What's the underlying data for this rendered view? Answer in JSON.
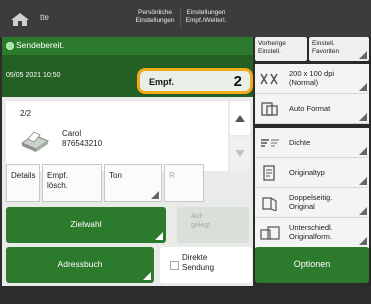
{
  "topbar": {
    "home_label": "tte",
    "btn_personal_line1": "Persönliche",
    "btn_personal_line2": "Einstellungen",
    "btn_settings_line1": "Einstellungen",
    "btn_settings_line2": "Empf./Weiterl."
  },
  "status": {
    "text": "Sendebereit.",
    "datetime": "05/05 2021 10:50"
  },
  "empf": {
    "label": "Empf.",
    "count": "2"
  },
  "destination": {
    "counter": "2/2",
    "name": "Carol",
    "number": "876543210"
  },
  "tabs": [
    {
      "line1": "Details",
      "line2": ""
    },
    {
      "line1": "Empf.",
      "line2": "lösch."
    },
    {
      "line1": "Ton",
      "line2": ""
    },
    {
      "line1": "R",
      "line2": ""
    }
  ],
  "buttons": {
    "zielwahl": "Zielwahl",
    "aufgelegt_line1": "Auf-",
    "aufgelegt_line2": "gelegt",
    "adressbuch": "Adressbuch",
    "direkte_line1": "Direkte",
    "direkte_line2": "Sendung",
    "optionen": "Optionen"
  },
  "right_top": {
    "vorherige_line1": "Vorherige",
    "vorherige_line2": "Einstell.",
    "favoriten_line1": "Einstell.",
    "favoriten_line2": "Favoriten"
  },
  "settings": [
    {
      "icon": "resolution-icon",
      "line1": "200 x 100 dpi",
      "line2": "(Normal)"
    },
    {
      "icon": "auto-format-icon",
      "line1": "Auto Format",
      "line2": ""
    },
    {
      "icon": "density-icon",
      "line1": "Dichte",
      "line2": ""
    },
    {
      "icon": "original-type-icon",
      "line1": "Originaltyp",
      "line2": ""
    },
    {
      "icon": "duplex-original-icon",
      "line1": "Doppelseitig.",
      "line2": "Original"
    },
    {
      "icon": "different-size-icon",
      "line1": "Unterschiedl.",
      "line2": "Originalform."
    }
  ],
  "colors": {
    "accent_green": "#2c7a2c",
    "highlight_orange": "#f2a91c"
  }
}
